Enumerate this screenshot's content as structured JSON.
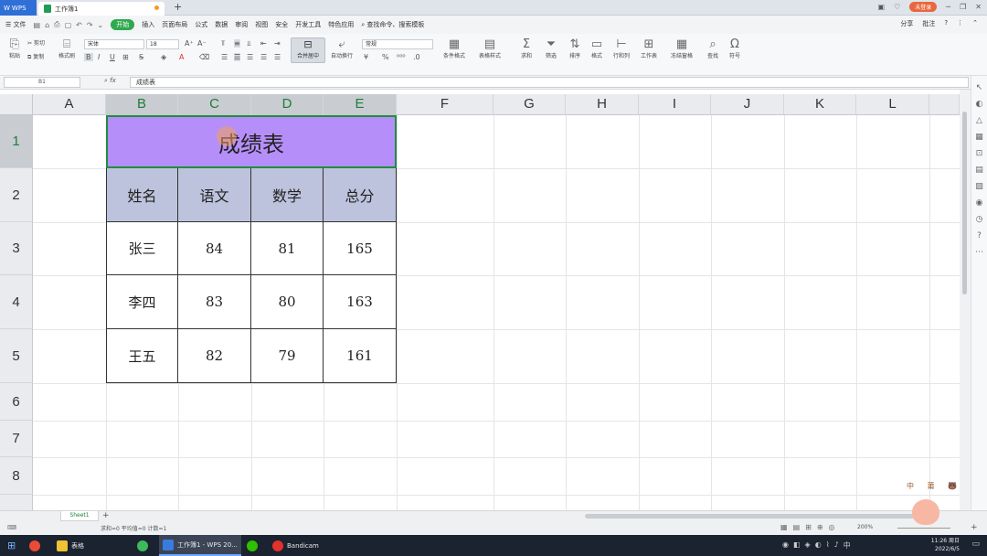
{
  "titlebar": {
    "app": "WPS",
    "tab": "工作簿1",
    "new_tab": "+",
    "login": "未登录"
  },
  "menu": {
    "file": "文件",
    "items": [
      "开始",
      "插入",
      "页面布局",
      "公式",
      "数据",
      "审阅",
      "视图",
      "安全",
      "开发工具",
      "特色应用"
    ],
    "search": "查找命令、搜索模板",
    "share": "分享",
    "comment": "批注"
  },
  "ribbon": {
    "paste": "粘贴",
    "cut": "剪切",
    "copy": "复制",
    "format_painter": "格式刷",
    "font_name": "宋体",
    "font_size": "18",
    "merge_center": "合并居中",
    "wrap": "自动换行",
    "number_format": "常规",
    "cond_format": "条件格式",
    "table_style": "表格样式",
    "sum": "求和",
    "filter": "筛选",
    "sort": "排序",
    "format": "格式",
    "rowcol": "行和列",
    "worksheet": "工作表",
    "freeze": "冻结窗格",
    "find": "查找",
    "symbol": "符号"
  },
  "formula": {
    "cell_ref": "B1",
    "fx": "fx",
    "content": "成绩表"
  },
  "columns": [
    "A",
    "B",
    "C",
    "D",
    "E",
    "F",
    "G",
    "H",
    "I",
    "J",
    "K",
    "L"
  ],
  "rows": [
    "1",
    "2",
    "3",
    "4",
    "5",
    "6",
    "7",
    "8"
  ],
  "table": {
    "title": "成绩表",
    "headers": [
      "姓名",
      "语文",
      "数学",
      "总分"
    ],
    "rows": [
      [
        "张三",
        "84",
        "81",
        "165"
      ],
      [
        "李四",
        "83",
        "80",
        "163"
      ],
      [
        "王五",
        "82",
        "79",
        "161"
      ]
    ]
  },
  "sheet": {
    "tab": "Sheet1",
    "add": "+"
  },
  "status": {
    "text": "求和=0  平均值=0  计数=1",
    "zoom": "200%"
  },
  "mascot": {
    "label": "中 莆 🐻"
  },
  "taskbar": {
    "items": [
      "表格",
      "工作簿1 - WPS 20...",
      "Bandicam"
    ],
    "ime": "中",
    "time": "11:26 周日",
    "date": "2022/6/5"
  }
}
